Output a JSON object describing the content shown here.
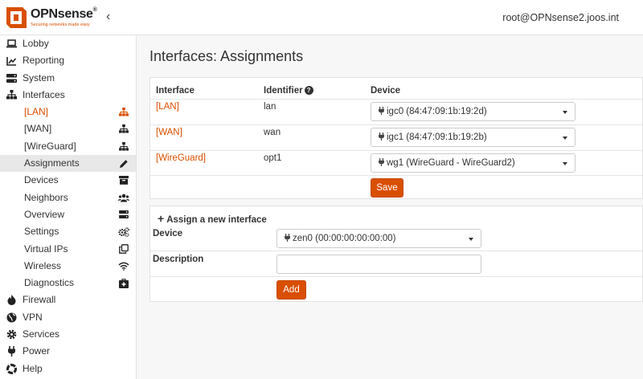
{
  "brand": {
    "name": "OPNsense",
    "tagline": "Securing networks made easy",
    "accent": "#d94f00"
  },
  "user": "root@OPNsense2.joos.int",
  "sidebar": {
    "items": [
      {
        "label": "Lobby",
        "icon": "laptop-icon"
      },
      {
        "label": "Reporting",
        "icon": "chart-icon"
      },
      {
        "label": "System",
        "icon": "server-icon"
      },
      {
        "label": "Interfaces",
        "icon": "sitemap-icon"
      },
      {
        "label": "[LAN]",
        "icon": "sitemap-icon"
      },
      {
        "label": "[WAN]",
        "icon": "sitemap-icon"
      },
      {
        "label": "[WireGuard]",
        "icon": "sitemap-icon"
      },
      {
        "label": "Assignments",
        "icon": "pencil-icon"
      },
      {
        "label": "Devices",
        "icon": "archive-icon"
      },
      {
        "label": "Neighbors",
        "icon": "users-icon"
      },
      {
        "label": "Overview",
        "icon": "server-icon"
      },
      {
        "label": "Settings",
        "icon": "cogs-icon"
      },
      {
        "label": "Virtual IPs",
        "icon": "clone-icon"
      },
      {
        "label": "Wireless",
        "icon": "wifi-icon"
      },
      {
        "label": "Diagnostics",
        "icon": "medkit-icon"
      },
      {
        "label": "Firewall",
        "icon": "fire-icon"
      },
      {
        "label": "VPN",
        "icon": "globe-icon"
      },
      {
        "label": "Services",
        "icon": "cog-icon"
      },
      {
        "label": "Power",
        "icon": "plug-icon"
      },
      {
        "label": "Help",
        "icon": "lifebuoy-icon"
      }
    ]
  },
  "page": {
    "title": "Interfaces: Assignments"
  },
  "assignments": {
    "headers": {
      "interface": "Interface",
      "identifier": "Identifier",
      "device": "Device",
      "help": "?"
    },
    "rows": [
      {
        "interface": "[LAN]",
        "identifier": "lan",
        "device": "igc0 (84:47:09:1b:19:2d)"
      },
      {
        "interface": "[WAN]",
        "identifier": "wan",
        "device": "igc1 (84:47:09:1b:19:2b)"
      },
      {
        "interface": "[WireGuard]",
        "identifier": "opt1",
        "device": "wg1 (WireGuard - WireGuard2)"
      }
    ],
    "save_label": "Save"
  },
  "new_interface": {
    "title": "Assign a new interface",
    "plus": "+",
    "device_label": "Device",
    "device_value": "zen0 (00:00:00:00:00:00)",
    "description_label": "Description",
    "description_value": "",
    "add_label": "Add"
  }
}
